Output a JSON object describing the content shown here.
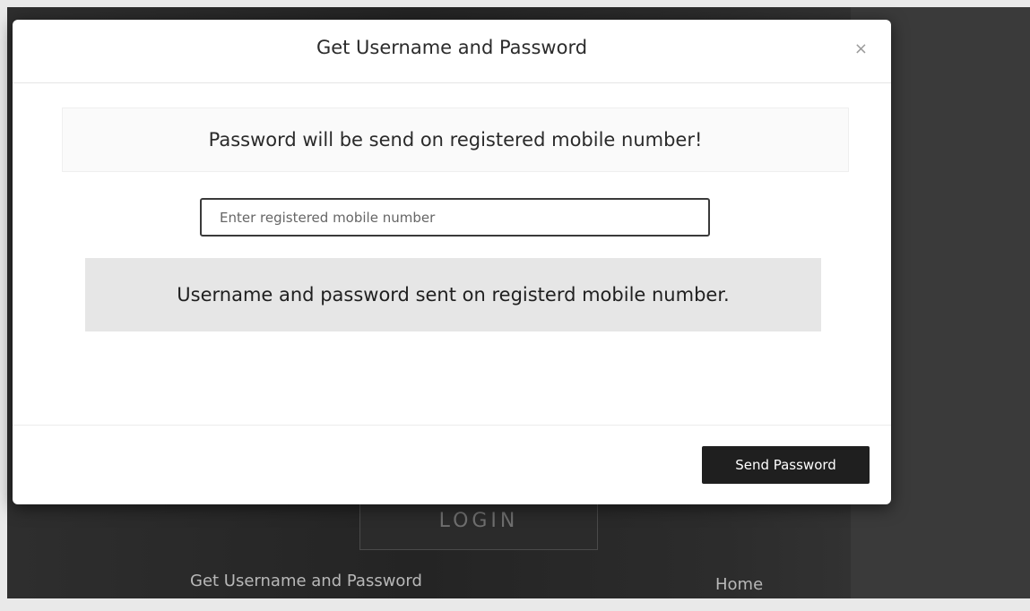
{
  "modal": {
    "title": "Get Username and Password",
    "close_label": "×",
    "info_text": "Password will be send on registered mobile number!",
    "mobile_input": {
      "value": "",
      "placeholder": "Enter registered mobile number"
    },
    "success_message": "Username and password sent on registerd mobile number.",
    "send_button_label": "Send Password"
  },
  "background_page": {
    "login_button_label": "LOGIN",
    "footer_links": {
      "get_credentials": "Get Username and Password",
      "home": "Home"
    }
  },
  "colors": {
    "modal_background": "#ffffff",
    "send_button": "#1f1f1f",
    "success_box": "#e6e6e6",
    "backdrop": "#2e2e2e"
  }
}
